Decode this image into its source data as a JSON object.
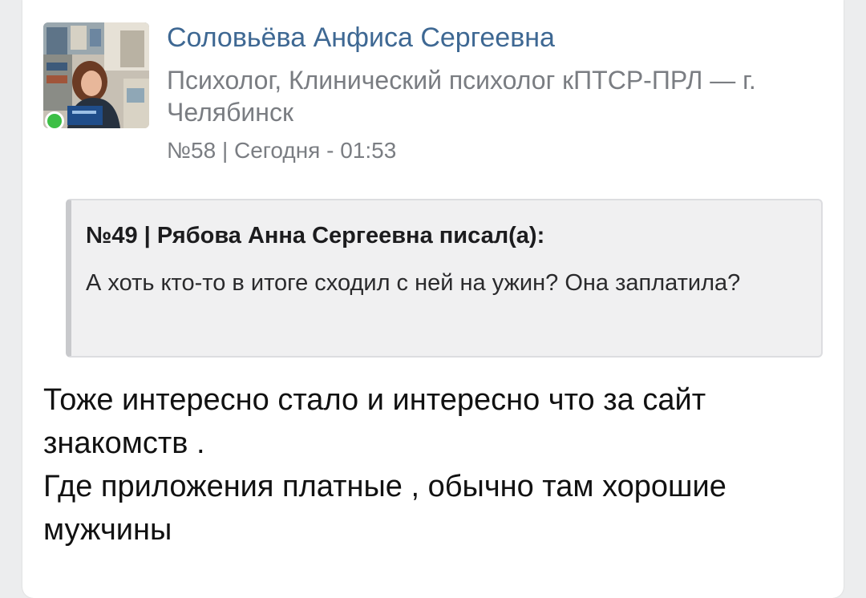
{
  "post": {
    "author_name": "Соловьёва Анфиса Сергеевна",
    "author_title": "Психолог, Клинический психолог кПТСР-ПРЛ — г. Челябинск",
    "meta": "№58 | Сегодня - 01:53",
    "online_color": "#3cbf45",
    "name_color": "#3e6893"
  },
  "quote": {
    "header": "№49 | Рябова Анна Сергеевна писал(а):",
    "text": "А хоть кто-то в итоге сходил с ней на ужин? Она заплатила?"
  },
  "message": {
    "line1": "Тоже интересно стало и интересно что за сайт знакомств .",
    "line2": "Где приложения платные , обычно там хорошие мужчины"
  }
}
